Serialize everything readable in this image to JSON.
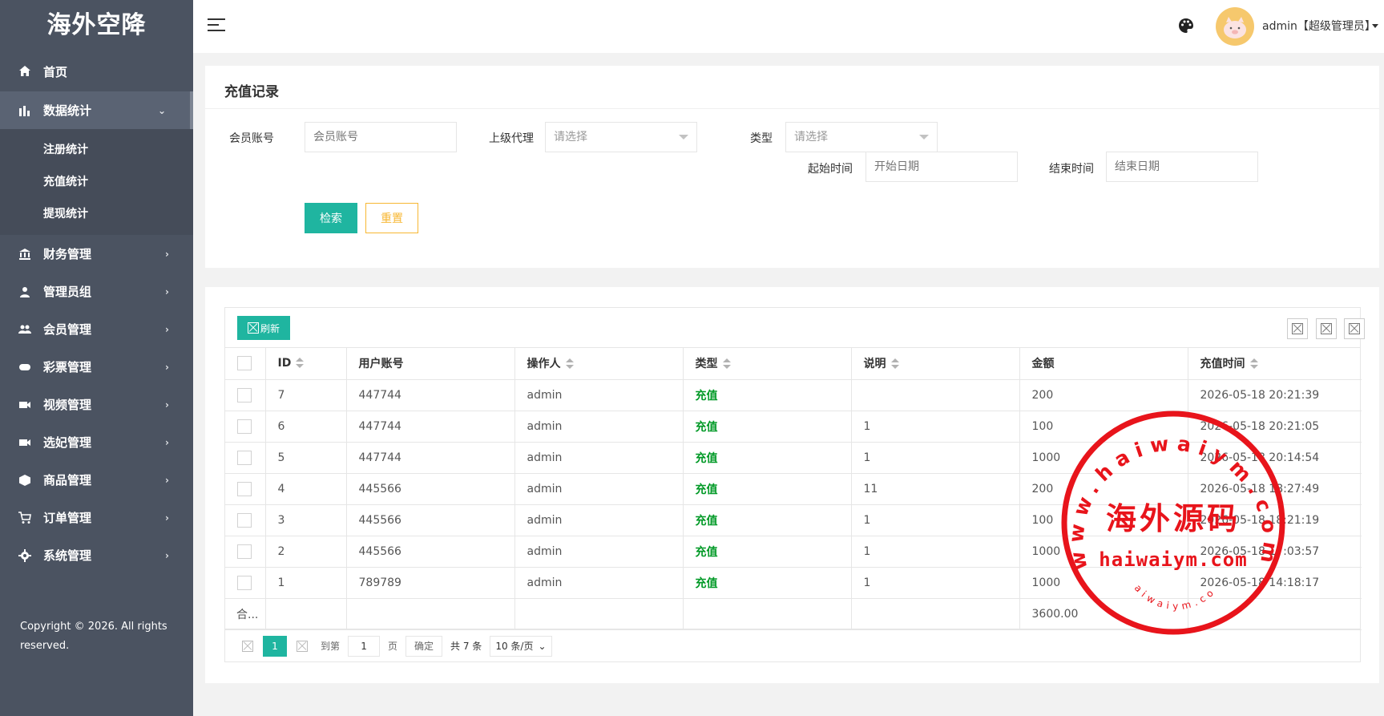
{
  "app": {
    "title": "海外空降"
  },
  "sidebar": {
    "items": [
      {
        "label": "首页",
        "icon": "home-icon"
      },
      {
        "label": "数据统计",
        "icon": "bar-chart-icon",
        "expanded": true,
        "children": [
          {
            "label": "注册统计"
          },
          {
            "label": "充值统计"
          },
          {
            "label": "提现统计"
          }
        ]
      },
      {
        "label": "财务管理",
        "icon": "bank-icon"
      },
      {
        "label": "管理员组",
        "icon": "user-icon"
      },
      {
        "label": "会员管理",
        "icon": "users-icon"
      },
      {
        "label": "彩票管理",
        "icon": "gamepad-icon"
      },
      {
        "label": "视频管理",
        "icon": "video-icon"
      },
      {
        "label": "选妃管理",
        "icon": "video-icon"
      },
      {
        "label": "商品管理",
        "icon": "cube-icon"
      },
      {
        "label": "订单管理",
        "icon": "cart-icon"
      },
      {
        "label": "系统管理",
        "icon": "gear-icon"
      }
    ],
    "copyright": "Copyright © 2026. All rights reserved."
  },
  "header": {
    "user_name": "admin【超级管理员】"
  },
  "search": {
    "title": "充值记录",
    "member_label": "会员账号",
    "member_placeholder": "会员账号",
    "agent_label": "上级代理",
    "agent_value": "请选择",
    "type_label": "类型",
    "type_value": "请选择",
    "start_label": "起始时间",
    "start_placeholder": "开始日期",
    "end_label": "结束时间",
    "end_placeholder": "结束日期",
    "search_button": "检索",
    "reset_button": "重置"
  },
  "table": {
    "refresh_label": "刷新",
    "columns": [
      "ID",
      "用户账号",
      "操作人",
      "类型",
      "说明",
      "金额",
      "充值时间"
    ],
    "rows": [
      [
        "7",
        "447744",
        "admin",
        "充值",
        "",
        "200",
        "2026-05-18 20:21:39"
      ],
      [
        "6",
        "447744",
        "admin",
        "充值",
        "1",
        "100",
        "2026-05-18 20:21:05"
      ],
      [
        "5",
        "447744",
        "admin",
        "充值",
        "1",
        "1000",
        "2026-05-18 20:14:54"
      ],
      [
        "4",
        "445566",
        "admin",
        "充值",
        "11",
        "200",
        "2026-05-18 18:27:49"
      ],
      [
        "3",
        "445566",
        "admin",
        "充值",
        "1",
        "100",
        "2026-05-18 18:21:19"
      ],
      [
        "2",
        "445566",
        "admin",
        "充值",
        "1",
        "1000",
        "2026-05-18 17:03:57"
      ],
      [
        "1",
        "789789",
        "admin",
        "充值",
        "1",
        "1000",
        "2026-05-18 14:18:17"
      ]
    ],
    "total_label": "合...",
    "total_amount": "3600.00"
  },
  "pager": {
    "current_page": "1",
    "goto_label": "到第",
    "goto_value": "1",
    "page_unit": "页",
    "confirm_label": "确定",
    "total_text": "共 7 条",
    "page_size": "10 条/页"
  },
  "watermark": {
    "outer_text": "www.haiwaiym.com",
    "center_text": "海外源码",
    "bottom_text": "haiwaiym.com",
    "small_text": "haiwaiym.com",
    "color": "#e8141b"
  },
  "colors": {
    "sidebar": "#4b5361",
    "accent": "#1fb5a0",
    "reset": "#f7b733",
    "type_green": "#009926"
  }
}
